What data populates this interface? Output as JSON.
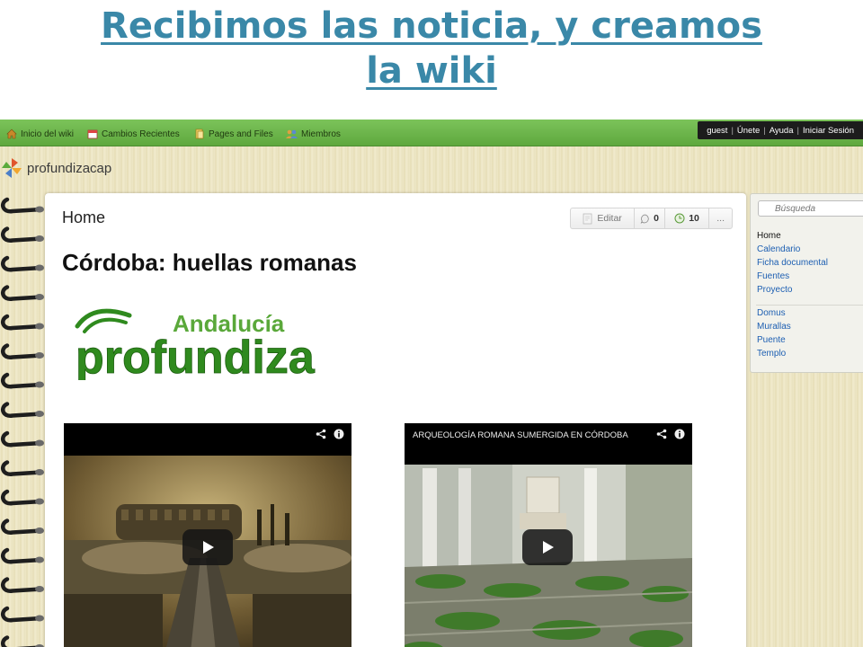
{
  "slide": {
    "title": "Recibimos las noticia, y creamos la wiki"
  },
  "topbar": {
    "items": [
      {
        "label": "Inicio del wiki",
        "icon": "home-icon"
      },
      {
        "label": "Cambios Recientes",
        "icon": "calendar-icon"
      },
      {
        "label": "Pages and Files",
        "icon": "files-icon"
      },
      {
        "label": "Miembros",
        "icon": "members-icon"
      }
    ],
    "account": {
      "guest": "guest",
      "join": "Únete",
      "help": "Ayuda",
      "login": "Iniciar Sesión"
    }
  },
  "site": {
    "name": "profundizacap"
  },
  "page": {
    "name": "Home",
    "heading": "Córdoba: huellas romanas",
    "toolbar": {
      "edit_label": "Editar",
      "comments_count": "0",
      "history_count": "10",
      "more_label": "..."
    },
    "brand": {
      "line1": "Andalucía",
      "line2": "profundiza"
    },
    "videos": [
      {
        "title": ""
      },
      {
        "title": "ARQUEOLOGÍA ROMANA SUMERGIDA EN CÓRDOBA"
      }
    ]
  },
  "sidebar": {
    "search_placeholder": "Búsqueda",
    "group1": [
      "Home",
      "Calendario",
      "Ficha documental",
      "Fuentes",
      "Proyecto"
    ],
    "group2": [
      "Domus",
      "Murallas",
      "Puente",
      "Templo"
    ]
  },
  "colors": {
    "title": "#3a88a8",
    "topbar": "#6db64b",
    "link": "#1d5fb2",
    "brand_green": "#2f8a1e"
  }
}
